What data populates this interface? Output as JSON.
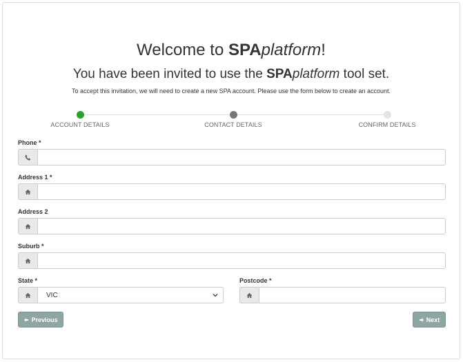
{
  "header": {
    "welcome_prefix": "Welcome to ",
    "brand_bold": "SPA",
    "brand_italic": "platform",
    "welcome_suffix": "!",
    "invite_prefix": "You have been invited to use the ",
    "invite_suffix": " tool set.",
    "subtitle": "To accept this invitation, we will need to create a new SPA account. Please use the form below to create an account."
  },
  "steps": [
    {
      "label": "ACCOUNT DETAILS",
      "state": "complete",
      "color": "#2ca02c"
    },
    {
      "label": "CONTACT DETAILS",
      "state": "current",
      "color": "#777777"
    },
    {
      "label": "CONFIRM DETAILS",
      "state": "upcoming",
      "color": "#e3e3e3"
    }
  ],
  "form": {
    "phone": {
      "label": "Phone *",
      "value": "",
      "icon": "phone-icon"
    },
    "address1": {
      "label": "Address 1 *",
      "value": "",
      "icon": "home-icon"
    },
    "address2": {
      "label": "Address 2",
      "value": "",
      "icon": "home-icon"
    },
    "suburb": {
      "label": "Suburb *",
      "value": "",
      "icon": "home-icon"
    },
    "state": {
      "label": "State *",
      "value": "VIC",
      "icon": "home-icon"
    },
    "postcode": {
      "label": "Postcode *",
      "value": "",
      "icon": "home-icon"
    }
  },
  "buttons": {
    "previous": "Previous",
    "next": "Next",
    "color": "#8ea5a4"
  }
}
